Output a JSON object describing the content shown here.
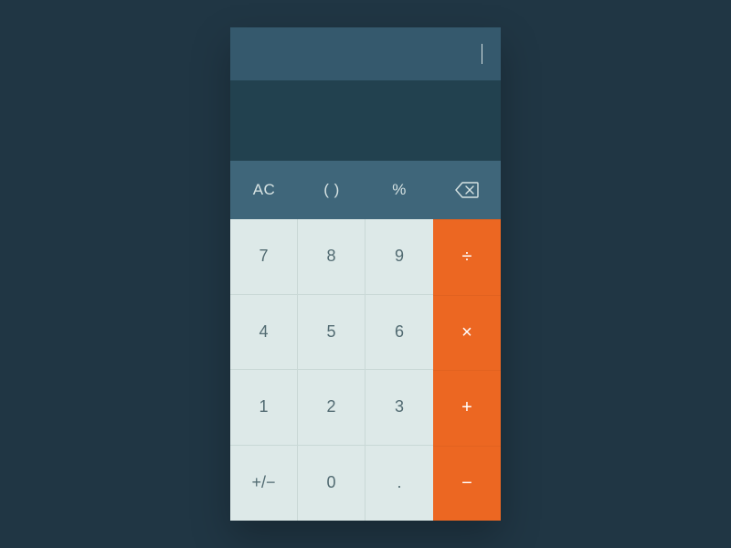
{
  "display": {
    "input": "",
    "result": ""
  },
  "fn_row": {
    "clear": "AC",
    "parens": "( )",
    "percent": "%",
    "backspace_icon": "backspace"
  },
  "keys": {
    "r1": {
      "a": "7",
      "b": "8",
      "c": "9",
      "op": "÷"
    },
    "r2": {
      "a": "4",
      "b": "5",
      "c": "6",
      "op": "×"
    },
    "r3": {
      "a": "1",
      "b": "2",
      "c": "3",
      "op": "+"
    },
    "r4": {
      "a": "+/−",
      "b": "0",
      "c": ".",
      "op": "−"
    }
  },
  "colors": {
    "bg": "#203644",
    "display_top": "#35596d",
    "display_mid": "#22414f",
    "fn": "#3f667a",
    "num": "#dde9e8",
    "num_text": "#526b72",
    "op": "#ec6722"
  }
}
